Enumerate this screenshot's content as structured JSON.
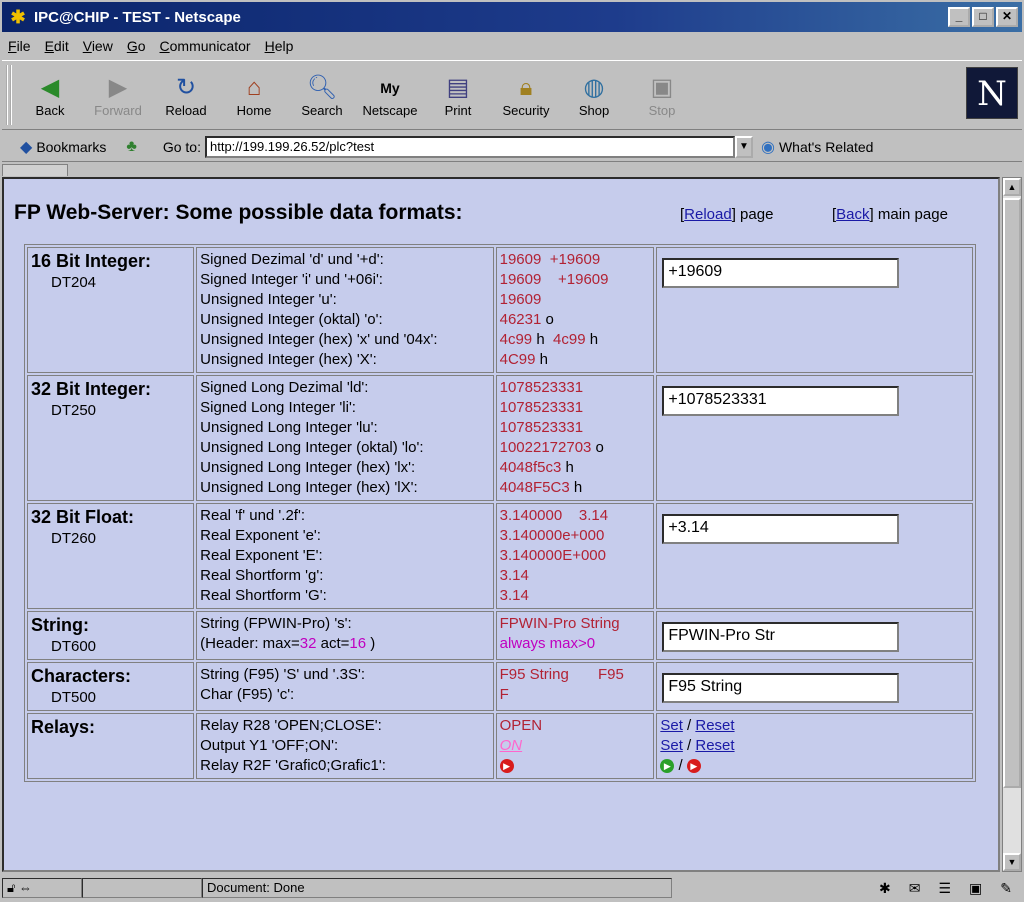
{
  "window": {
    "title": "IPC@CHIP - TEST - Netscape"
  },
  "menu": [
    "File",
    "Edit",
    "View",
    "Go",
    "Communicator",
    "Help"
  ],
  "toolbar": [
    {
      "label": "Back",
      "icon": "back-arrow-icon",
      "enabled": true
    },
    {
      "label": "Forward",
      "icon": "forward-arrow-icon",
      "enabled": false
    },
    {
      "label": "Reload",
      "icon": "reload-icon",
      "enabled": true
    },
    {
      "label": "Home",
      "icon": "home-icon",
      "enabled": true
    },
    {
      "label": "Search",
      "icon": "search-icon",
      "enabled": true
    },
    {
      "label": "Netscape",
      "icon": "netscape-icon",
      "enabled": true
    },
    {
      "label": "Print",
      "icon": "print-icon",
      "enabled": true
    },
    {
      "label": "Security",
      "icon": "lock-icon",
      "enabled": true
    },
    {
      "label": "Shop",
      "icon": "shop-icon",
      "enabled": true
    },
    {
      "label": "Stop",
      "icon": "stop-icon",
      "enabled": false
    }
  ],
  "logo_letter": "N",
  "location": {
    "bookmarks_label": "Bookmarks",
    "goto_label": "Go to:",
    "url": "http://199.199.26.52/plc?test",
    "related_label": "What's Related"
  },
  "page": {
    "title": "FP Web-Server: Some possible data formats:",
    "reload_link": "Reload",
    "reload_suffix": " page",
    "back_link": "Back",
    "back_suffix": " main page",
    "sections": [
      {
        "title": "16 Bit Integer:",
        "addr": "DT204",
        "desc": [
          "Signed Dezimal 'd' und '+d':",
          "Signed Integer 'i' und '+06i':",
          "Unsigned Integer 'u':",
          "Unsigned Integer (oktal) 'o':",
          "Unsigned Integer (hex) 'x' und '04x':",
          "Unsigned Integer (hex) 'X':"
        ],
        "field": "+19609"
      },
      {
        "title": "32 Bit Integer:",
        "addr": "DT250",
        "desc": [
          "Signed Long Dezimal 'ld':",
          "Signed Long Integer 'li':",
          "Unsigned Long Integer 'lu':",
          "Unsigned Long Integer (oktal) 'lo':",
          "Unsigned Long Integer (hex) 'lx':",
          "Unsigned Long Integer (hex) 'lX':"
        ],
        "field": "+1078523331"
      },
      {
        "title": "32 Bit Float:",
        "addr": "DT260",
        "desc": [
          "Real 'f' und '.2f':",
          "Real Exponent 'e':",
          "Real Exponent 'E':",
          "Real Shortform 'g':",
          "Real Shortform 'G':"
        ],
        "field": "+3.14"
      },
      {
        "title": "String:",
        "addr": "DT600",
        "desc": [
          "String (FPWIN-Pro) 's':"
        ],
        "field": "FPWIN-Pro Str"
      },
      {
        "title": "Characters:",
        "addr": "DT500",
        "desc": [
          "String (F95) 'S' und '.3S':",
          "Char (F95) 'c':"
        ],
        "field": "F95 String"
      },
      {
        "title": "Relays:",
        "desc": [
          "Relay R28 'OPEN;CLOSE':",
          "Output Y1 'OFF;ON':",
          "Relay R2F 'Grafic0;Grafic1':"
        ]
      }
    ],
    "v16": [
      {
        "a": "19609",
        "b": "+19609"
      },
      {
        "a": "19609",
        "b": "+19609"
      },
      {
        "a": "19609"
      },
      {
        "a": "46231",
        "suffix": " o"
      },
      {
        "a": "4c99",
        "s1": " h",
        "b": "4c99",
        "s2": " h"
      },
      {
        "a": "4C99",
        "suffix": " h"
      }
    ],
    "v32": [
      {
        "a": "1078523331"
      },
      {
        "a": "1078523331"
      },
      {
        "a": "1078523331"
      },
      {
        "a": "10022172703",
        "suffix": " o"
      },
      {
        "a": "4048f5c3",
        "suffix": " h"
      },
      {
        "a": "4048F5C3",
        "suffix": " h"
      }
    ],
    "vfloat": [
      "3.140000",
      "3.14",
      "3.140000e+000",
      "3.140000E+000",
      "3.14",
      "3.14"
    ],
    "header_line": {
      "prefix": "(Header: max=",
      "max": "32",
      "mid": " act=",
      "act": "16",
      "suffix": " )"
    },
    "string_vals": [
      "FPWIN-Pro String",
      "always max>0"
    ],
    "char_vals": [
      "F95 String",
      "F95",
      "F"
    ],
    "relay_vals": [
      "OPEN",
      "ON"
    ],
    "relay_links": {
      "set": "Set",
      "reset": "Reset",
      "sep": " / "
    }
  },
  "status": {
    "text": "Document: Done"
  }
}
